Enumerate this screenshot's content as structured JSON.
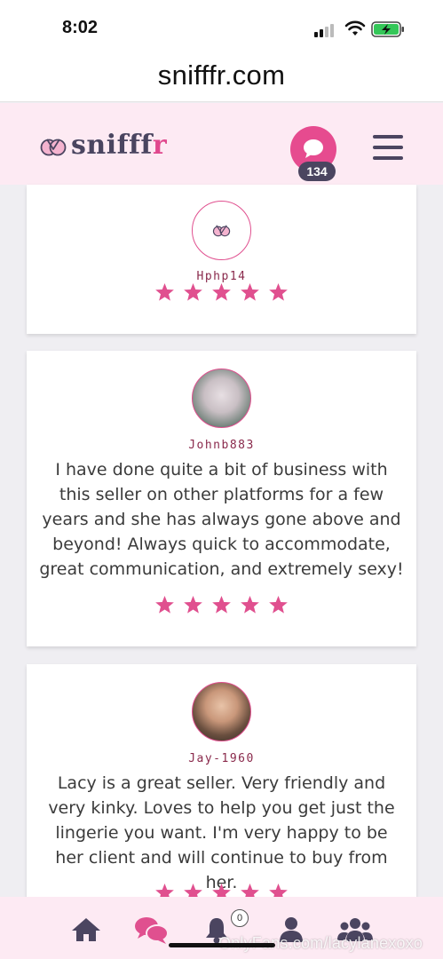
{
  "status_bar": {
    "time": "8:02"
  },
  "browser": {
    "address": "snifffr.com"
  },
  "header": {
    "logo_text": "snifff",
    "logo_text_accent": "r",
    "message_count": "134",
    "brand_color": "#e64b8f",
    "dark_color": "#4b4560"
  },
  "reviews": [
    {
      "username": "Hphp14",
      "text": "",
      "rating": 5,
      "avatar": "default-logo"
    },
    {
      "username": "Johnb883",
      "text": "I have done quite a bit of business with this seller on other platforms for a few years and she has always gone above and beyond! Always quick to accommodate, great communication, and extremely sexy!",
      "rating": 5,
      "avatar": "photo"
    },
    {
      "username": "Jay-1960",
      "text": "Lacy is a great seller. Very friendly and very kinky. Loves to help you get just the lingerie you want. I'm very happy to be her client and will continue to buy from her.",
      "rating": 5,
      "avatar": "photo"
    }
  ],
  "bottom_nav": {
    "items": [
      "home-icon",
      "messages-icon",
      "notifications-icon",
      "profile-icon",
      "community-icon"
    ],
    "notification_count": "0",
    "watermark": "OnlyFans.com/lacylanexoxo"
  }
}
